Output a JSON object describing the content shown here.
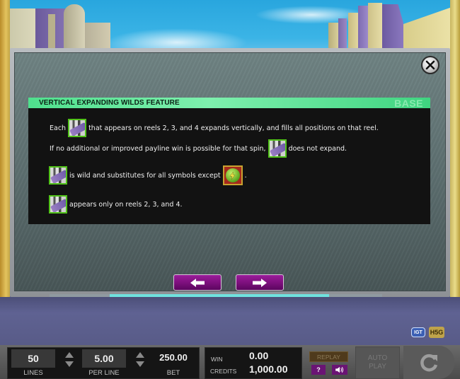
{
  "dialog": {
    "close_icon": "close-x-icon",
    "header": {
      "title": "VERTICAL EXPANDING WILDS FEATURE",
      "mode": "BASE"
    },
    "lines": [
      {
        "before": "Each",
        "symbol": "wild-symbol",
        "after": "that appears on reels 2, 3, and 4 expands vertically, and fills all positions on that reel."
      },
      {
        "before": "If no additional or improved payline win is possible for that spin,",
        "symbol": "wild-symbol",
        "after": "does not expand."
      },
      {
        "before": "",
        "symbol": "wild-symbol",
        "after": "is wild and substitutes for all symbols except",
        "symbol2": "scatter-lightning-symbol",
        "after2": "."
      },
      {
        "before": "",
        "symbol": "wild-symbol",
        "after": "appears only on reels 2, 3, and 4."
      }
    ],
    "nav": {
      "prev_icon": "arrow-left-icon",
      "next_icon": "arrow-right-icon"
    },
    "page_progress": {
      "start_fraction": 0.18,
      "end_fraction": 0.84
    }
  },
  "logos": {
    "igt": "IGT",
    "h5": "H5G"
  },
  "controls": {
    "lines": {
      "value": "50",
      "label": "LINES"
    },
    "per_line": {
      "value": "5.00",
      "label": "PER LINE"
    },
    "bet": {
      "value": "250.00",
      "label": "BET"
    },
    "win": {
      "label": "WIN",
      "value": "0.00"
    },
    "credits": {
      "label": "CREDITS",
      "value": "1,000.00"
    },
    "replay_label": "REPLAY",
    "help_label": "?",
    "sound_icon": "speaker-icon",
    "autoplay_label": "AUTO\nPLAY",
    "spin_icon": "spin-refresh-icon"
  },
  "colors": {
    "header_green": "#4fe08d",
    "nav_purple": "#7e107e",
    "progress_cyan": "#6fe2df",
    "wild_border": "#52c21a"
  }
}
